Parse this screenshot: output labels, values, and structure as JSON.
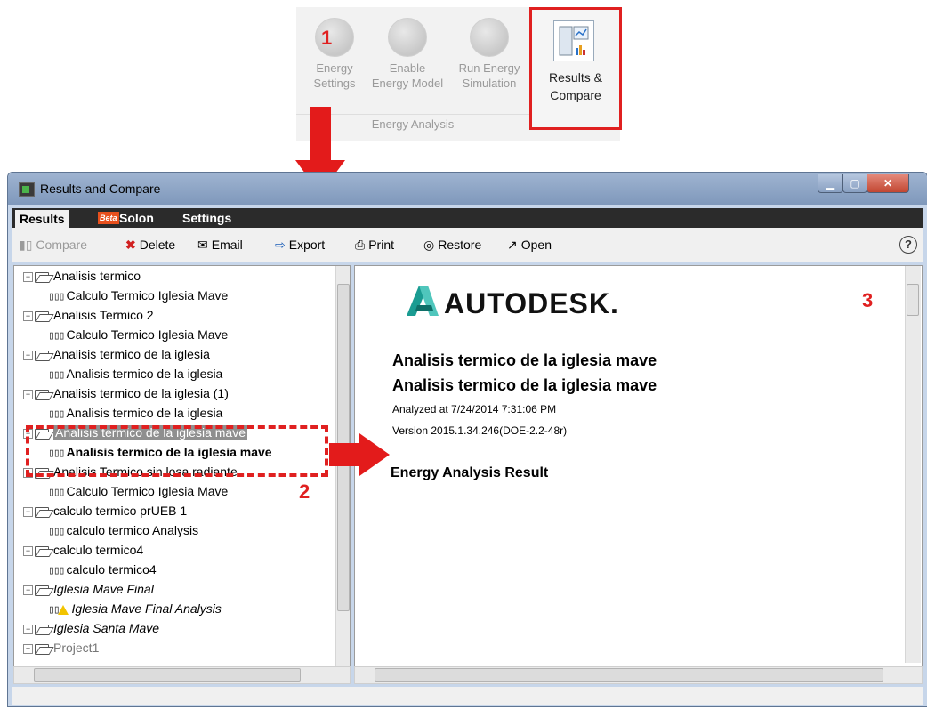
{
  "ribbon": {
    "buttons": [
      {
        "line1": "Energy",
        "line2": "Settings"
      },
      {
        "line1": "Enable",
        "line2": "Energy Model"
      },
      {
        "line1": "Run Energy",
        "line2": "Simulation"
      }
    ],
    "results_compare": {
      "line1": "Results &",
      "line2": "Compare"
    },
    "section_label": "Energy Analysis"
  },
  "callouts": {
    "one": "1",
    "two": "2",
    "three": "3"
  },
  "window": {
    "title": "Results and Compare",
    "tabs": {
      "results": "Results",
      "beta": "Beta",
      "solon": "Solon",
      "settings": "Settings"
    },
    "toolbar": {
      "compare": "Compare",
      "delete": "Delete",
      "email": "Email",
      "export": "Export",
      "print": "Print",
      "restore": "Restore",
      "open": "Open"
    }
  },
  "tree": {
    "items": [
      {
        "folder": "Analisis termico",
        "child": "Calculo Termico Iglesia Mave"
      },
      {
        "folder": "Analisis Termico 2",
        "child": "Calculo Termico Iglesia Mave"
      },
      {
        "folder": "Analisis termico de la iglesia",
        "child": "Analisis termico de la iglesia"
      },
      {
        "folder": "Analisis termico de la iglesia (1)",
        "child": "Analisis termico de la iglesia"
      },
      {
        "folder": "Analisis termico de la iglesia mave",
        "child": "Analisis termico de la iglesia mave"
      },
      {
        "folder": "Analisis Termico sin losa radiante",
        "child": "Calculo Termico Iglesia Mave"
      },
      {
        "folder": "calculo termico prUEB 1",
        "child": "calculo termico Analysis"
      },
      {
        "folder": "calculo termico4",
        "child": "calculo termico4"
      },
      {
        "folder": "Iglesia Mave Final",
        "child": "Iglesia Mave Final Analysis"
      },
      {
        "folder": "Iglesia Santa Mave",
        "child": ""
      }
    ],
    "partial_last": "Project1"
  },
  "content": {
    "brand": "AUTODESK.",
    "heading1": "Analisis termico de la iglesia mave",
    "heading2": "Analisis termico de la iglesia mave",
    "analyzed": "Analyzed at 7/24/2014 7:31:06 PM",
    "version": "Version 2015.1.34.246(DOE-2.2-48r)",
    "result_title": "Energy Analysis Result"
  },
  "colors": {
    "accent_red": "#e02020",
    "autodesk_teal": "#1fb1a8"
  }
}
